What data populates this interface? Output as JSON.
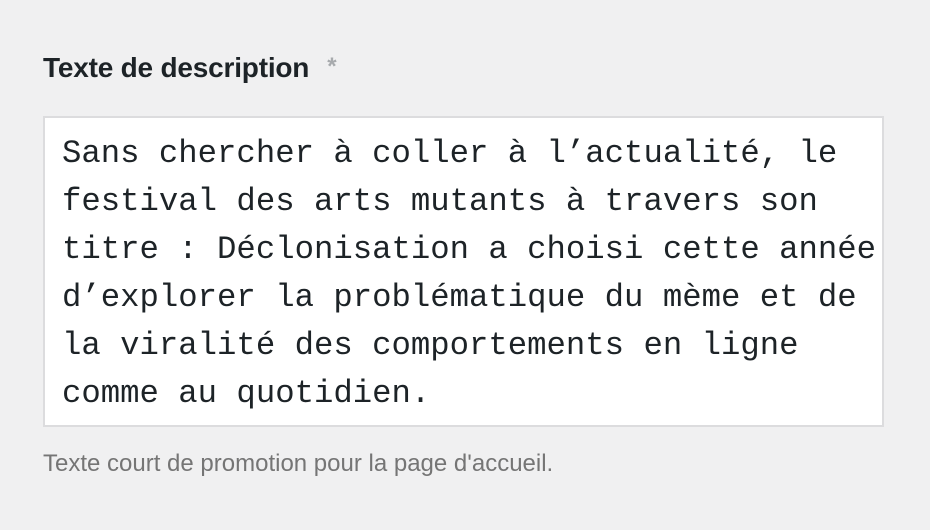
{
  "field": {
    "label": "Texte de description",
    "required_marker": "*",
    "value_lines": [
      "Sans chercher à coller à l’actualité, le",
      "festival des arts mutants à travers son",
      "titre : Déclonisation a choisi cette année",
      "d’explorer la problématique du mème et de",
      "la viralité des comportements en ligne",
      "comme au quotidien."
    ],
    "help_text": "Texte court de promotion pour la page d'accueil."
  }
}
